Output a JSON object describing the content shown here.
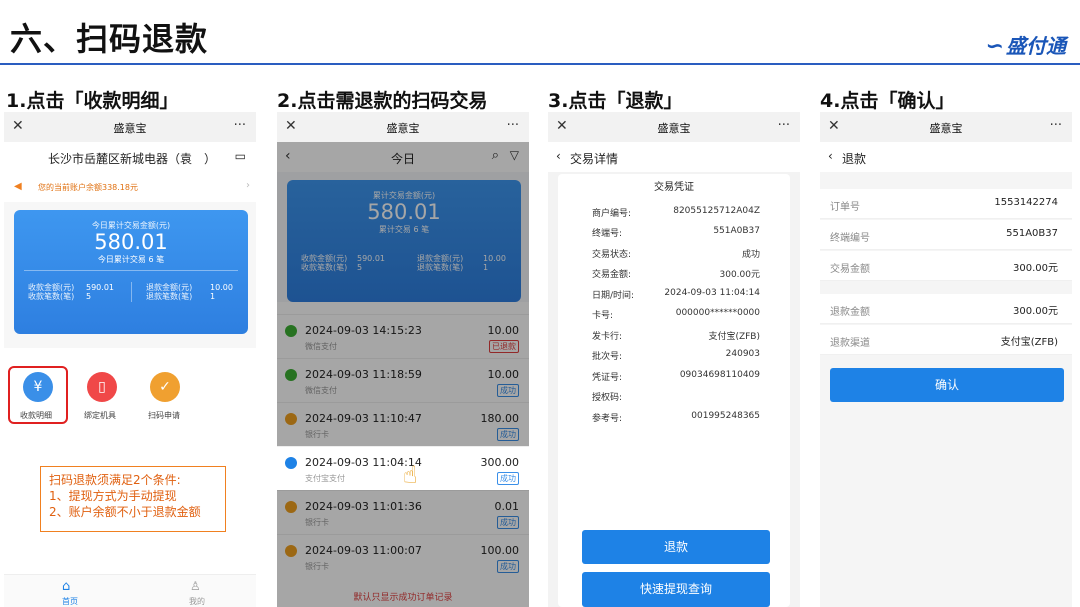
{
  "header": {
    "title": "六、扫码退款",
    "logo": "盛付通"
  },
  "steps": [
    "1.点击「收款明细」",
    "2.点击需退款的扫码交易",
    "3.点击「退款」",
    "4.点击「确认」"
  ],
  "app": {
    "name": "盛意宝",
    "close": "✕",
    "more": "···"
  },
  "p1": {
    "store": "长沙市岳麓区新城电器（袁　）",
    "notice": "您的当前账户余额338.18元",
    "card_label": "今日累计交易金额(元)",
    "card_amount": "580.01",
    "card_count": "今日累计交易 6 笔",
    "recv_amount_label": "收款金额(元)",
    "recv_count_label": "收款笔数(笔)",
    "recv_amount": "590.01",
    "recv_count": "5",
    "refund_amount_label": "退款金额(元)",
    "refund_count_label": "退款笔数(笔)",
    "refund_amount": "10.00",
    "refund_count": "1",
    "menu": [
      "收款明细",
      "绑定机具",
      "扫码申请"
    ],
    "callout": [
      "扫码退款须满足2个条件:",
      "1、提现方式为手动提现",
      "2、账户余额不小于退款金额"
    ],
    "nav": [
      "首页",
      "我的"
    ]
  },
  "p2": {
    "title": "今日",
    "card_label": "累计交易金额(元)",
    "card_amount": "580.01",
    "card_count": "累计交易 6 笔",
    "recv_amount_label": "收款金额(元)",
    "recv_count_label": "收款笔数(笔)",
    "recv_amount": "590.01",
    "recv_count": "5",
    "refund_amount_label": "退款金额(元)",
    "refund_count_label": "退款笔数(笔)",
    "refund_amount": "10.00",
    "refund_count": "1",
    "transactions": [
      {
        "time": "2024-09-03 14:15:23",
        "method": "微信支付",
        "amount": "10.00",
        "status": "已退款",
        "color": "#3cb034"
      },
      {
        "time": "2024-09-03 11:18:59",
        "method": "微信支付",
        "amount": "10.00",
        "status": "成功",
        "color": "#3cb034"
      },
      {
        "time": "2024-09-03 11:10:47",
        "method": "银行卡",
        "amount": "180.00",
        "status": "成功",
        "color": "#f0a020"
      },
      {
        "time": "2024-09-03 11:04:14",
        "method": "支付宝支付",
        "amount": "300.00",
        "status": "成功",
        "color": "#1e82e6"
      },
      {
        "time": "2024-09-03 11:01:36",
        "method": "银行卡",
        "amount": "0.01",
        "status": "成功",
        "color": "#f0a020"
      },
      {
        "time": "2024-09-03 11:00:07",
        "method": "银行卡",
        "amount": "100.00",
        "status": "成功",
        "color": "#f0a020"
      }
    ],
    "footer": "默认只显示成功订单记录"
  },
  "p3": {
    "back_title": "交易详情",
    "receipt_title": "交易凭证",
    "rows": [
      [
        "商户编号:",
        "82055125712A04Z"
      ],
      [
        "终端号:",
        "551A0B37"
      ],
      [
        "交易状态:",
        "成功"
      ],
      [
        "交易金额:",
        "300.00元"
      ],
      [
        "日期/时间:",
        "2024-09-03 11:04:14"
      ],
      [
        "卡号:",
        "000000******0000"
      ],
      [
        "发卡行:",
        "支付宝(ZFB)"
      ],
      [
        "批次号:",
        "240903"
      ],
      [
        "凭证号:",
        "09034698110409"
      ],
      [
        "授权码:",
        ""
      ],
      [
        "参考号:",
        "001995248365"
      ]
    ],
    "refund_btn": "退款",
    "quick_btn": "快速提现查询"
  },
  "p4": {
    "back_title": "退款",
    "rows": [
      [
        "订单号",
        "1553142274"
      ],
      [
        "终端编号",
        "551A0B37"
      ],
      [
        "交易金额",
        "300.00元"
      ],
      [
        "退款金额",
        "300.00元"
      ],
      [
        "退款渠道",
        "支付宝(ZFB)"
      ]
    ],
    "confirm_btn": "确认"
  }
}
